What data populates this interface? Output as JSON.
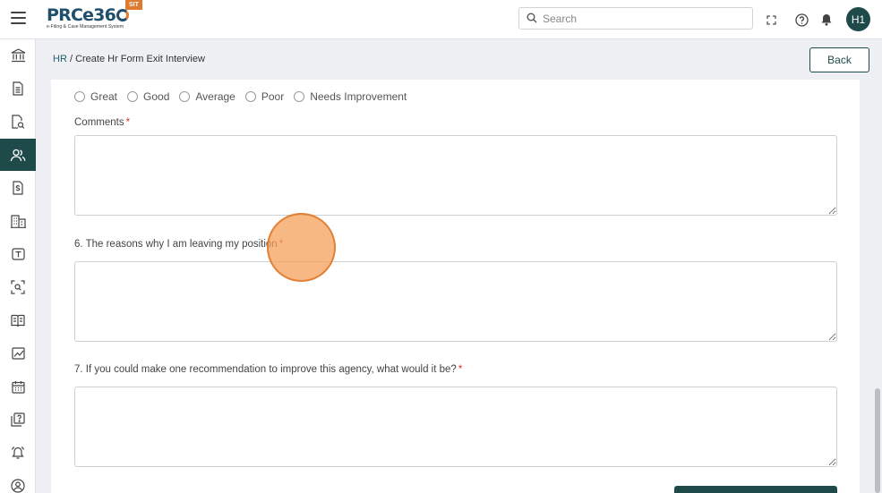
{
  "header": {
    "logo_text": "PRCe36",
    "logo_subtitle": "e-Filing & Case Management System",
    "env_badge": "SIT",
    "search_placeholder": "Search",
    "avatar_initials": "H1"
  },
  "sidebar": {
    "items": [
      {
        "icon": "bank-icon"
      },
      {
        "icon": "document-icon"
      },
      {
        "icon": "document-search-icon"
      },
      {
        "icon": "users-icon",
        "active": true
      },
      {
        "icon": "invoice-dollar-icon"
      },
      {
        "icon": "building-icon"
      },
      {
        "icon": "template-icon"
      },
      {
        "icon": "scan-search-icon"
      },
      {
        "icon": "book-icon"
      },
      {
        "icon": "chart-icon"
      },
      {
        "icon": "calendar-icon"
      },
      {
        "icon": "question-doc-icon"
      },
      {
        "icon": "bell-alarm-icon"
      },
      {
        "icon": "user-circle-icon"
      }
    ]
  },
  "breadcrumb": {
    "root": "HR",
    "separator": " / ",
    "current": "Create Hr Form Exit Interview"
  },
  "back_button": "Back",
  "form": {
    "rating_options": [
      "Great",
      "Good",
      "Average",
      "Poor",
      "Needs Improvement"
    ],
    "comments_label": "Comments",
    "q6_label": "6. The reasons why I am leaving my position",
    "q7_label": "7. If you could make one recommendation to improve this agency, what would it be?",
    "required_mark": "*"
  },
  "colors": {
    "brand_dark": "#1f4a4a",
    "accent_orange": "#e07a2e",
    "required_red": "#d9342b"
  }
}
